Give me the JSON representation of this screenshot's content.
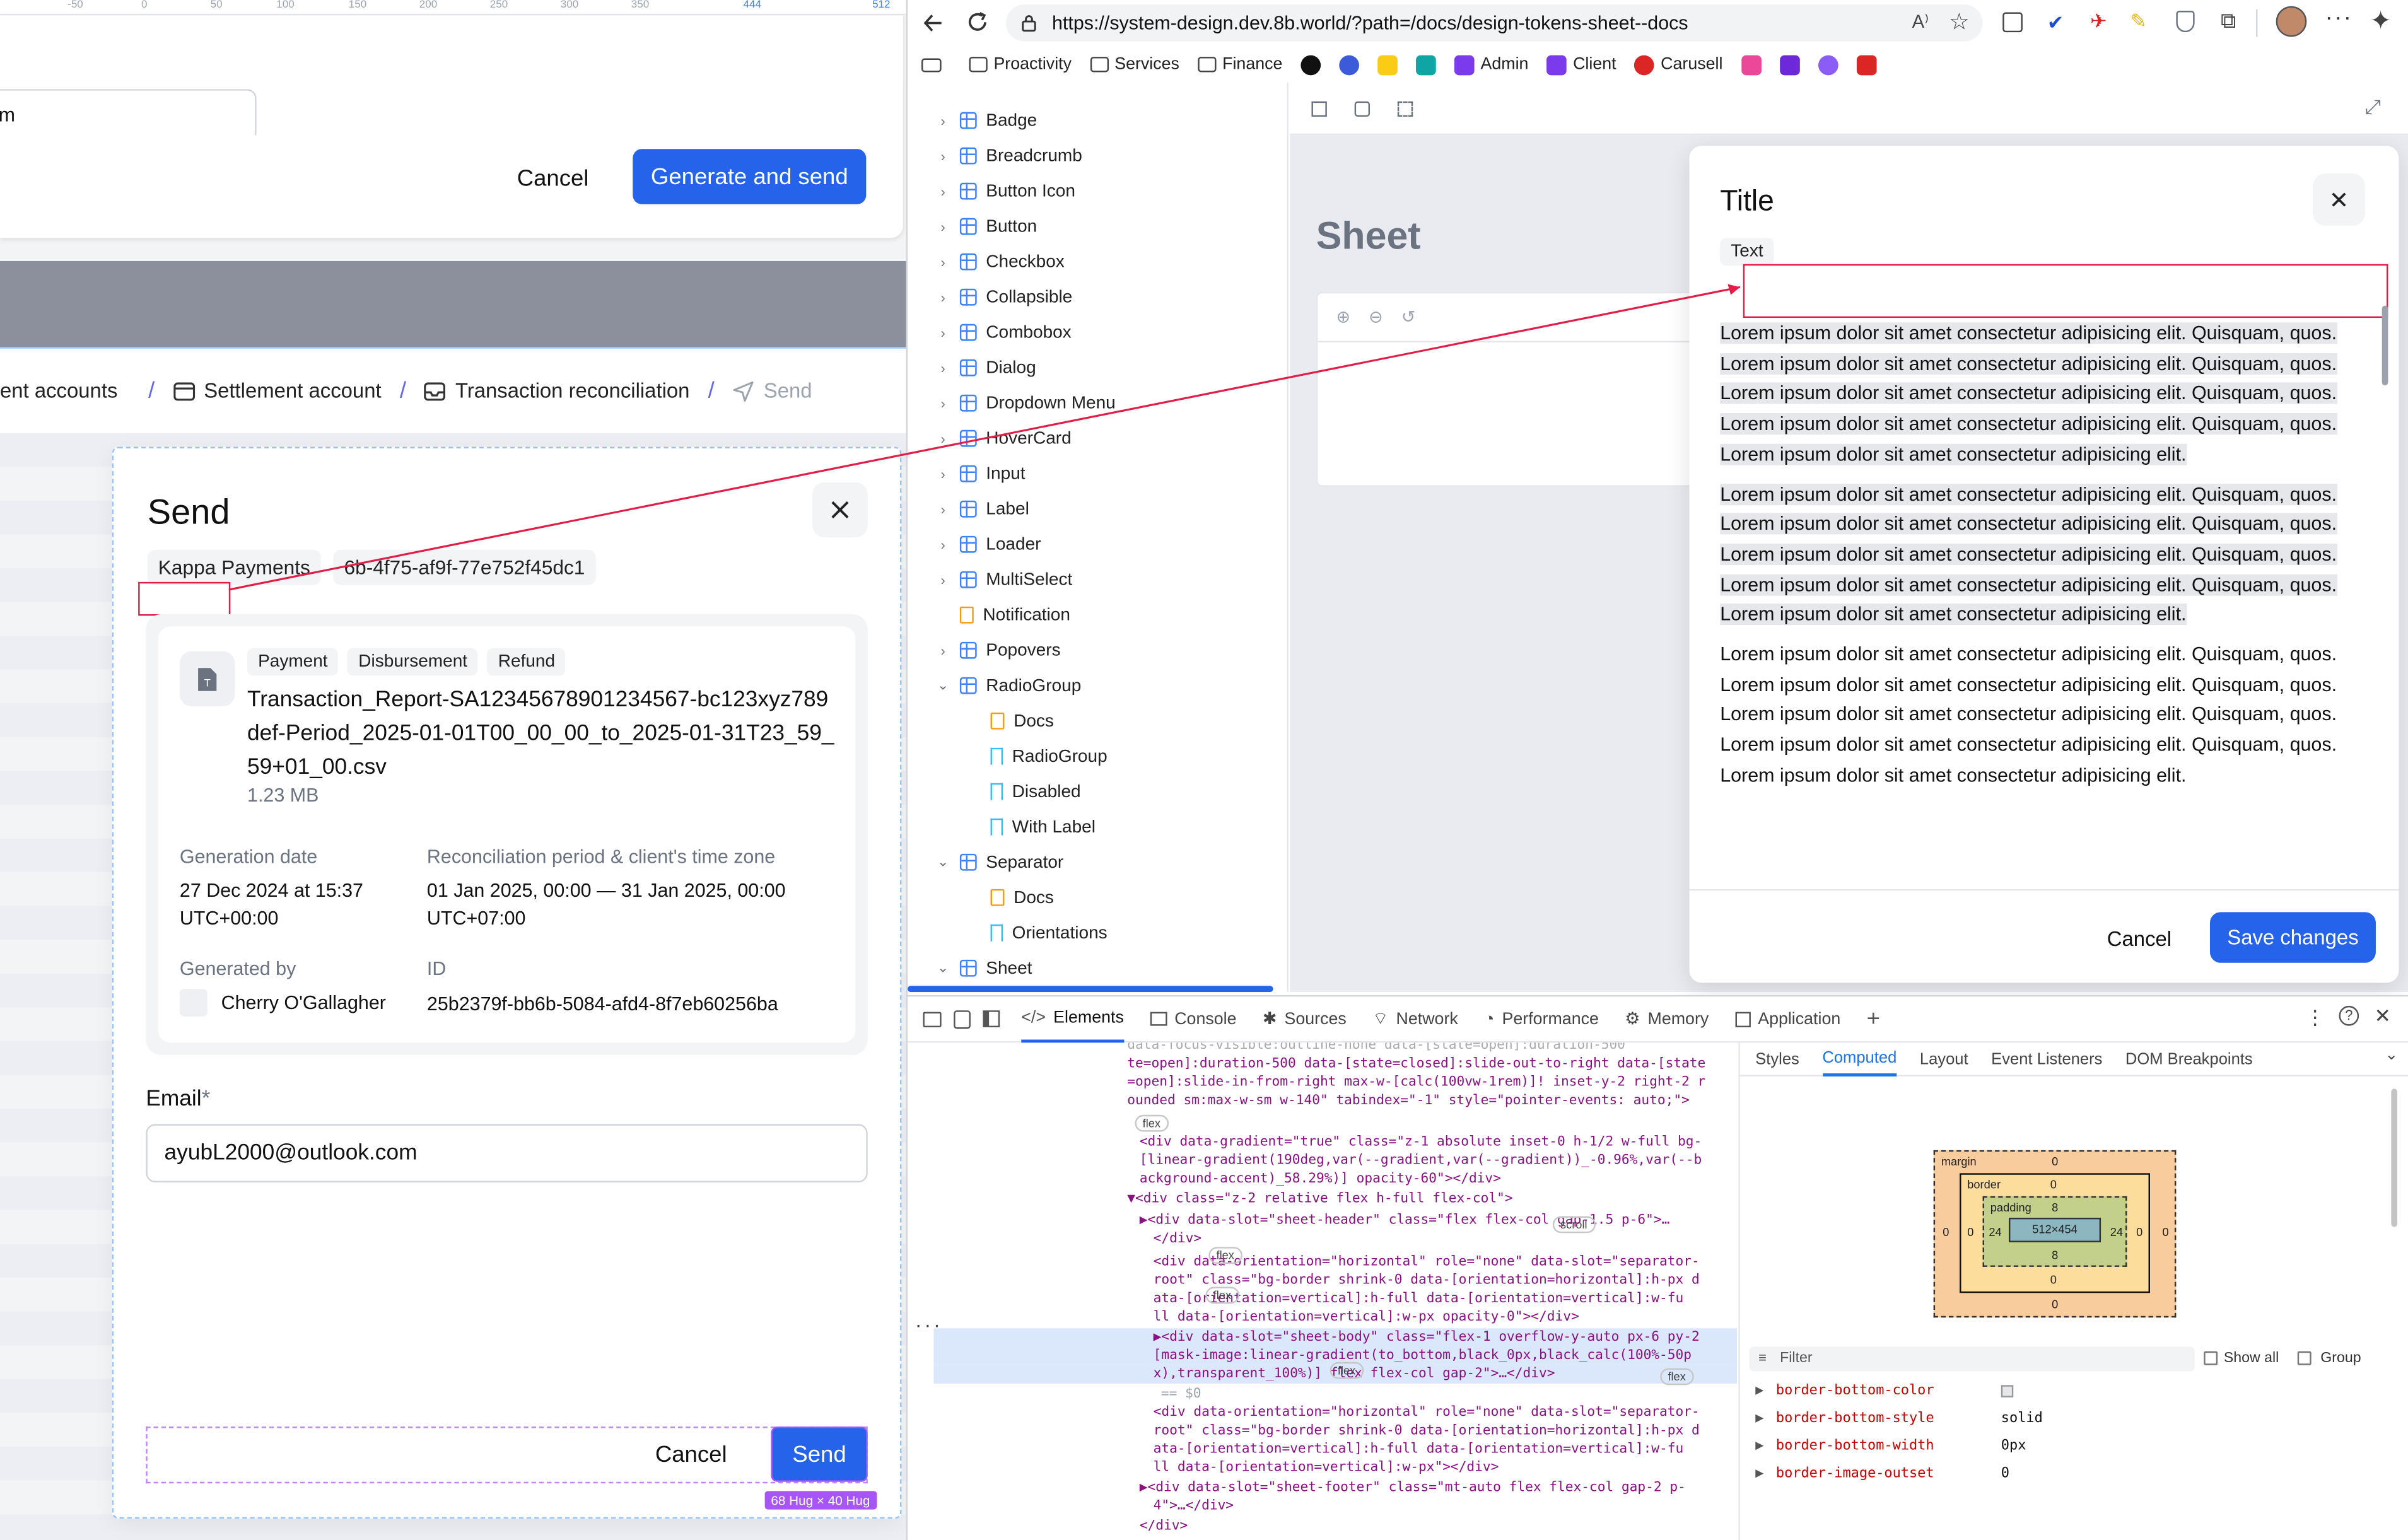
{
  "ruler": {
    "ticks": [
      "-50",
      "0",
      "50",
      "100",
      "150",
      "200",
      "250",
      "300",
      "350"
    ],
    "highlight": [
      "444",
      "512"
    ]
  },
  "top_dialog": {
    "partial_label": "m",
    "cancel": "Cancel",
    "primary": "Generate and send"
  },
  "breadcrumb": {
    "items": [
      "ent accounts",
      "Settlement account",
      "Transaction reconciliation",
      "Send"
    ],
    "sep": "/"
  },
  "send_dialog": {
    "title": "Send",
    "chips": [
      "Kappa Payments",
      "6b-4f75-af9f-77e752f45dc1"
    ],
    "file": {
      "tags": [
        "Payment",
        "Disbursement",
        "Refund"
      ],
      "name": "Transaction_Report-SA12345678901234567-bc123xyz789def-Period_2025-01-01T00_00_00_to_2025-01-31T23_59_59+01_00.csv",
      "name_lines": [
        "Transaction_Report-SA12345678901234567-bc123xyz789",
        "def-Period_2025-01-01T00_00_00_to_2025-01-31T23_59_",
        "59+01_00.csv"
      ],
      "size": "1.23 MB"
    },
    "meta": {
      "gen_date_label": "Generation date",
      "gen_date_value": "27 Dec 2024 at 15:37",
      "gen_date_tz": "UTC+00:00",
      "period_label": "Reconciliation period & client's time zone",
      "period_value": "01 Jan 2025, 00:00 — 31 Jan 2025, 00:00",
      "period_tz": "UTC+07:00",
      "gen_by_label": "Generated by",
      "gen_by_value": "Cherry O'Gallagher",
      "id_label": "ID",
      "id_value": "25b2379f-bb6b-5084-afd4-8f7eb60256ba"
    },
    "email_label": "Email",
    "email_required": "*",
    "email_value": "ayubL2000@outlook.com",
    "cancel": "Cancel",
    "send": "Send",
    "size_badge": "68 Hug × 40 Hug"
  },
  "browser": {
    "url": "https://system-design.dev.8b.world/?path=/docs/design-tokens-sheet--docs",
    "bookmarks": [
      "Proactivity",
      "Services",
      "Finance",
      "Admin",
      "Client",
      "Carusell"
    ]
  },
  "sidebar": {
    "items": [
      {
        "label": "Badge",
        "type": "component",
        "depth": 0,
        "chev": "›"
      },
      {
        "label": "Breadcrumb",
        "type": "component",
        "depth": 0,
        "chev": "›"
      },
      {
        "label": "Button Icon",
        "type": "component",
        "depth": 0,
        "chev": "›"
      },
      {
        "label": "Button",
        "type": "component",
        "depth": 0,
        "chev": "›"
      },
      {
        "label": "Checkbox",
        "type": "component",
        "depth": 0,
        "chev": "›"
      },
      {
        "label": "Collapsible",
        "type": "component",
        "depth": 0,
        "chev": "›"
      },
      {
        "label": "Combobox",
        "type": "component",
        "depth": 0,
        "chev": "›"
      },
      {
        "label": "Dialog",
        "type": "component",
        "depth": 0,
        "chev": "›"
      },
      {
        "label": "Dropdown Menu",
        "type": "component",
        "depth": 0,
        "chev": "›"
      },
      {
        "label": "HoverCard",
        "type": "component",
        "depth": 0,
        "chev": "›"
      },
      {
        "label": "Input",
        "type": "component",
        "depth": 0,
        "chev": "›"
      },
      {
        "label": "Label",
        "type": "component",
        "depth": 0,
        "chev": "›"
      },
      {
        "label": "Loader",
        "type": "component",
        "depth": 0,
        "chev": "›"
      },
      {
        "label": "MultiSelect",
        "type": "component",
        "depth": 0,
        "chev": "›"
      },
      {
        "label": "Notification",
        "type": "doc",
        "depth": 0,
        "chev": ""
      },
      {
        "label": "Popovers",
        "type": "component",
        "depth": 0,
        "chev": "›"
      },
      {
        "label": "RadioGroup",
        "type": "component",
        "depth": 0,
        "chev": "⌄"
      },
      {
        "label": "Docs",
        "type": "doc",
        "depth": 1,
        "chev": ""
      },
      {
        "label": "RadioGroup",
        "type": "story",
        "depth": 1,
        "chev": ""
      },
      {
        "label": "Disabled",
        "type": "story",
        "depth": 1,
        "chev": ""
      },
      {
        "label": "With Label",
        "type": "story",
        "depth": 1,
        "chev": ""
      },
      {
        "label": "Separator",
        "type": "component",
        "depth": 0,
        "chev": "⌄"
      },
      {
        "label": "Docs",
        "type": "doc",
        "depth": 1,
        "chev": ""
      },
      {
        "label": "Orientations",
        "type": "story",
        "depth": 1,
        "chev": ""
      },
      {
        "label": "Sheet",
        "type": "component",
        "depth": 0,
        "chev": "⌄"
      }
    ]
  },
  "canvas": {
    "heading": "Sheet"
  },
  "sheet": {
    "title": "Title",
    "chip": "Text",
    "paragraphs": [
      "Lorem ipsum dolor sit amet consectetur adipisicing elit. Quisquam, quos. Lorem ipsum dolor sit amet consectetur adipisicing elit. Quisquam, quos. Lorem ipsum dolor sit amet consectetur adipisicing elit. Quisquam, quos. Lorem ipsum dolor sit amet consectetur adipisicing elit. Quisquam, quos. Lorem ipsum dolor sit amet consectetur adipisicing elit.",
      "Lorem ipsum dolor sit amet consectetur adipisicing elit. Quisquam, quos. Lorem ipsum dolor sit amet consectetur adipisicing elit. Quisquam, quos. Lorem ipsum dolor sit amet consectetur adipisicing elit. Quisquam, quos. Lorem ipsum dolor sit amet consectetur adipisicing elit. Quisquam, quos. Lorem ipsum dolor sit amet consectetur adipisicing elit.",
      "Lorem ipsum dolor sit amet consectetur adipisicing elit. Quisquam, quos. Lorem ipsum dolor sit amet consectetur adipisicing elit. Quisquam, quos. Lorem ipsum dolor sit amet consectetur adipisicing elit. Quisquam, quos. Lorem ipsum dolor sit amet consectetur adipisicing elit. Quisquam, quos. Lorem ipsum dolor sit amet consectetur adipisicing elit."
    ],
    "cancel": "Cancel",
    "save": "Save changes"
  },
  "devtools": {
    "tabs": [
      "Elements",
      "Console",
      "Sources",
      "Network",
      "Performance",
      "Memory",
      "Application"
    ],
    "active_tab": "Elements",
    "panel_tabs": [
      "Styles",
      "Computed",
      "Layout",
      "Event Listeners",
      "DOM Breakpoints"
    ],
    "active_panel_tab": "Computed",
    "box_model": {
      "margin_label": "margin",
      "margin": [
        "0",
        "0",
        "0",
        "0"
      ],
      "border_label": "border",
      "border": [
        "0",
        "0",
        "0",
        "0"
      ],
      "padding_label": "padding",
      "padding": [
        "8",
        "24",
        "8",
        "24"
      ],
      "content": "512×454"
    },
    "filter_placeholder": "Filter",
    "show_all": "Show all",
    "group": "Group",
    "props": [
      {
        "name": "border-bottom-color",
        "value": ""
      },
      {
        "name": "border-bottom-style",
        "value": "solid"
      },
      {
        "name": "border-bottom-width",
        "value": "0px"
      },
      {
        "name": "border-image-outset",
        "value": "0"
      }
    ],
    "badges": [
      "flex",
      "flex",
      "flex",
      "scroll",
      "flex",
      "flex"
    ],
    "dollar": "== $0",
    "code_lines": [
      "te=open]:duration-500 data-[state=closed]:slide-out-to-right data-[state",
      "=open]:slide-in-from-right max-w-[calc(100vw-1rem)]! inset-y-2 right-2 r",
      "ounded sm:max-w-sm w-140\" tabindex=\"-1\" style=\"pointer-events: auto;\">",
      "<div data-gradient=\"true\" class=\"z-1 absolute inset-0 h-1/2 w-full bg-",
      "[linear-gradient(190deg,var(--gradient,var(--gradient))_-0.96%,var(--b",
      "ackground-accent)_58.29%)] opacity-60\"></div>",
      "▼<div class=\"z-2 relative flex h-full flex-col\">",
      "▶<div data-slot=\"sheet-header\" class=\"flex flex-col gap-1.5 p-6\">…",
      "</div>",
      "<div data-orientation=\"horizontal\" role=\"none\" data-slot=\"separator-",
      "root\" class=\"bg-border shrink-0 data-[orientation=horizontal]:h-px d",
      "ata-[orientation=vertical]:h-full data-[orientation=vertical]:w-fu",
      "ll data-[orientation=vertical]:w-px opacity-0\"></div>",
      "▶<div data-slot=\"sheet-body\" class=\"flex-1 overflow-y-auto px-6 py-2",
      "[mask-image:linear-gradient(to_bottom,black_0px,black_calc(100%-50p",
      "x),transparent_100%)] flex flex-col gap-2\">…</div>",
      "<div data-orientation=\"horizontal\" role=\"none\" data-slot=\"separator-",
      "root\" class=\"bg-border shrink-0 data-[orientation=horizontal]:h-px d",
      "ata-[orientation=vertical]:h-full data-[orientation=vertical]:w-fu",
      "ll data-[orientation=vertical]:w-px\"></div>",
      "▶<div data-slot=\"sheet-footer\" class=\"mt-auto flex flex-col gap-2 p-",
      "4\">…</div>",
      "</div>"
    ]
  },
  "colors": {
    "primary": "#2563eb",
    "annotation": "#e11d48",
    "size_badge": "#a855f7"
  }
}
